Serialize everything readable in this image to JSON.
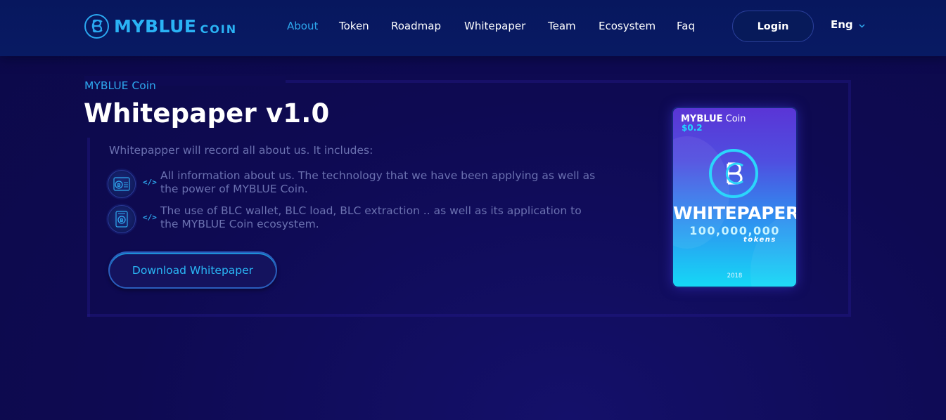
{
  "brand": {
    "name_main": "MYBLUE",
    "name_sub": "COIN",
    "color": "#2ab3f5"
  },
  "nav": {
    "items": [
      {
        "label": "About",
        "active": true
      },
      {
        "label": "Token",
        "active": false
      },
      {
        "label": "Roadmap",
        "active": false
      },
      {
        "label": "Whitepaper",
        "active": false
      },
      {
        "label": "Team",
        "active": false
      },
      {
        "label": "Ecosystem",
        "active": false
      },
      {
        "label": "Faq",
        "active": false
      }
    ],
    "login_label": "Login",
    "language": "Eng",
    "language_icon": "chevron-down-icon"
  },
  "hero": {
    "eyebrow": "MYBLUE Coin",
    "title": "Whitepaper v1.0",
    "intro": "Whitepapper will record all about us. It includes:",
    "features": [
      {
        "icon": "document-coin-icon",
        "marker_icon": "code-icon",
        "text": "All information about us. The technology that we have been applying as well as the power of MYBLUE Coin."
      },
      {
        "icon": "wallet-coin-icon",
        "marker_icon": "code-icon",
        "text": "The use of BLC wallet, BLC load, BLC extraction .. as well as its application to the MYBLUE Coin ecosystem."
      }
    ],
    "download_label": "Download Whitepaper"
  },
  "card": {
    "brand_bold": "MYBLUE",
    "brand_light": "Coin",
    "price": "$0.2",
    "title": "WHITEPAPER",
    "amount": "100,000,000",
    "unit": "tokens",
    "year": "2018"
  },
  "colors": {
    "accent": "#2ea8ee",
    "background": "#0e0a52",
    "navbar": "#081a63",
    "muted_text": "#6b71b0"
  }
}
